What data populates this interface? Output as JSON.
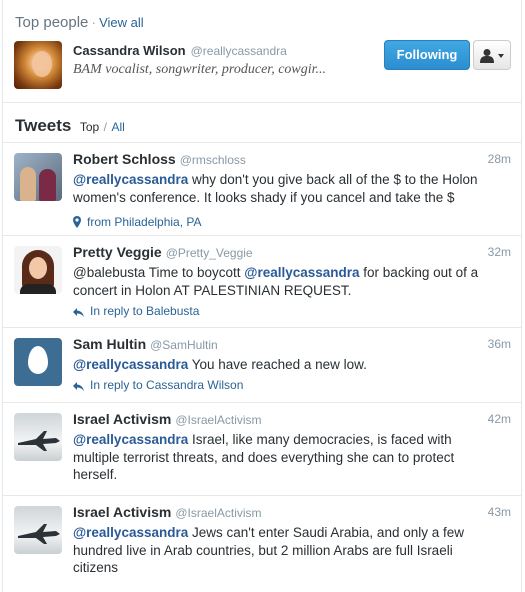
{
  "top_people": {
    "title": "Top people",
    "separator": "·",
    "view_all": "View all",
    "person": {
      "name": "Cassandra Wilson",
      "handle": "@reallycassandra",
      "bio": "BAM vocalist, songwriter, producer, cowgir...",
      "follow_label": "Following"
    }
  },
  "tweets_section": {
    "title": "Tweets",
    "top_label": "Top",
    "separator": "/",
    "all_label": "All"
  },
  "tweets": [
    {
      "name": "Robert Schloss",
      "handle": "@rmschloss",
      "time": "28m",
      "mention": "@reallycassandra",
      "text": " why don't you give back all of the $ to the Holon women's conference. It looks shady if you cancel and take the $",
      "meta": "from Philadelphia, PA"
    },
    {
      "name": "Pretty Veggie",
      "handle": "@Pretty_Veggie",
      "time": "32m",
      "text_before": "@balebusta Time to boycott ",
      "mention": "@reallycassandra",
      "text_after": " for backing out of a concert in Holon AT PALESTINIAN REQUEST.",
      "meta": "In reply to Balebusta"
    },
    {
      "name": "Sam Hultin",
      "handle": "@SamHultin",
      "time": "36m",
      "mention": "@reallycassandra",
      "text": " You have reached a new low.",
      "meta": "In reply to Cassandra Wilson"
    },
    {
      "name": "Israel Activism",
      "handle": "@IsraelActivism",
      "time": "42m",
      "mention": "@reallycassandra",
      "text": " Israel, like many democracies, is faced with multiple terrorist threats, and does everything she can to protect herself."
    },
    {
      "name": "Israel Activism",
      "handle": "@IsraelActivism",
      "time": "43m",
      "mention": "@reallycassandra",
      "text": " Jews can't enter Saudi Arabia, and only a few hundred live in Arab countries, but 2 million Arabs are full Israeli citizens"
    }
  ]
}
